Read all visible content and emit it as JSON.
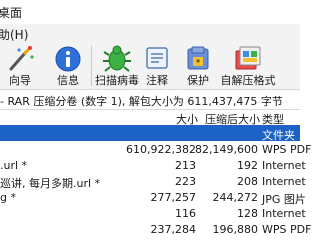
{
  "window": {
    "title": "桌面"
  },
  "menubar": {
    "label": "助(H)"
  },
  "toolbar": {
    "buttons": [
      {
        "label": "向导",
        "icon": "wand-icon"
      },
      {
        "label": "信息",
        "icon": "info-icon"
      },
      {
        "label": "扫描病毒",
        "icon": "virus-scan-icon"
      },
      {
        "label": "注释",
        "icon": "comment-icon"
      },
      {
        "label": "保护",
        "icon": "shield-icon"
      },
      {
        "label": "自解压格式",
        "icon": "sfx-icon"
      }
    ]
  },
  "pathbar": {
    "text": "- RAR 压缩分卷 (数字 1), 解包大小为 611,437,475 字节"
  },
  "columns": {
    "size": "大小",
    "packed": "压缩后大小",
    "type": "类型"
  },
  "files": [
    {
      "name": "",
      "size": "",
      "packed": "",
      "type": "文件夹"
    },
    {
      "name": "",
      "size": "610,922,382",
      "packed": "82,149,600",
      "type": "WPS PDF"
    },
    {
      "name": ".url *",
      "size": "213",
      "packed": "192",
      "type": "Internet"
    },
    {
      "name": "巡讲, 每月多期.url *",
      "size": "223",
      "packed": "208",
      "type": "Internet"
    },
    {
      "name": "g *",
      "size": "277,257",
      "packed": "244,272",
      "type": "JPG 图片"
    },
    {
      "name": "",
      "size": "116",
      "packed": "128",
      "type": "Internet"
    },
    {
      "name": "",
      "size": "237,284",
      "packed": "196,880",
      "type": "WPS PDF"
    }
  ],
  "colors": {
    "selection": "#1c62c7",
    "toolbar_bg": "#f3f3f3"
  }
}
